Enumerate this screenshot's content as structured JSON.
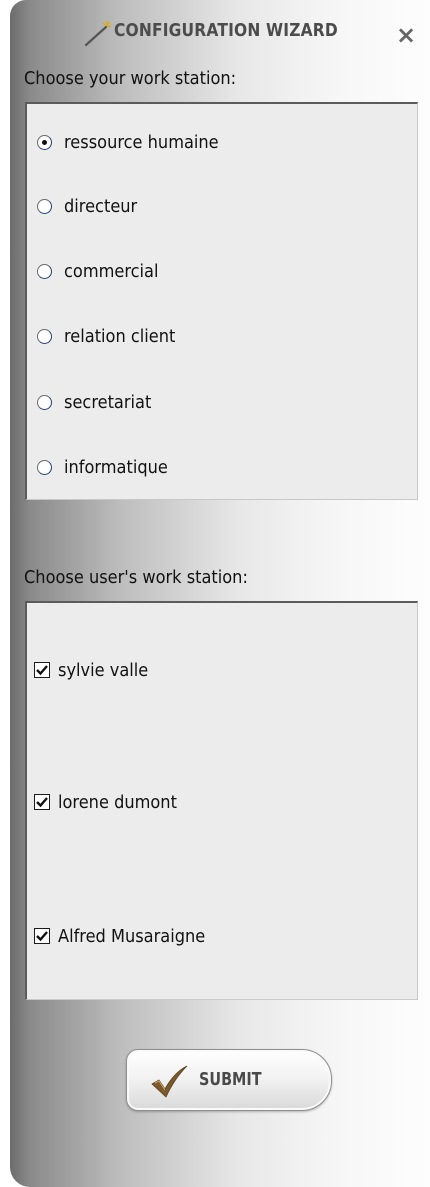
{
  "window": {
    "title": "CONFIGURATION WIZARD",
    "close_glyph": "×",
    "icons": {
      "title": "magic-wand-icon",
      "close": "close-icon"
    }
  },
  "own_station": {
    "label": "Choose your work station:",
    "selected": "ressource humaine",
    "options": [
      {
        "label": "ressource humaine",
        "checked": true
      },
      {
        "label": "directeur",
        "checked": false
      },
      {
        "label": "commercial",
        "checked": false
      },
      {
        "label": "relation client",
        "checked": false
      },
      {
        "label": "secretariat",
        "checked": false
      },
      {
        "label": "informatique",
        "checked": false
      }
    ]
  },
  "user_station": {
    "label": "Choose user's work station:",
    "users": [
      {
        "label": "sylvie valle",
        "checked": true
      },
      {
        "label": "lorene dumont",
        "checked": true
      },
      {
        "label": "Alfred Musaraigne",
        "checked": true
      }
    ]
  },
  "submit": {
    "label": "SUBMIT",
    "icon": "check-mark-icon"
  },
  "colors": {
    "panel_bg": "#ececec",
    "check_icon": "#7a5a2a"
  }
}
